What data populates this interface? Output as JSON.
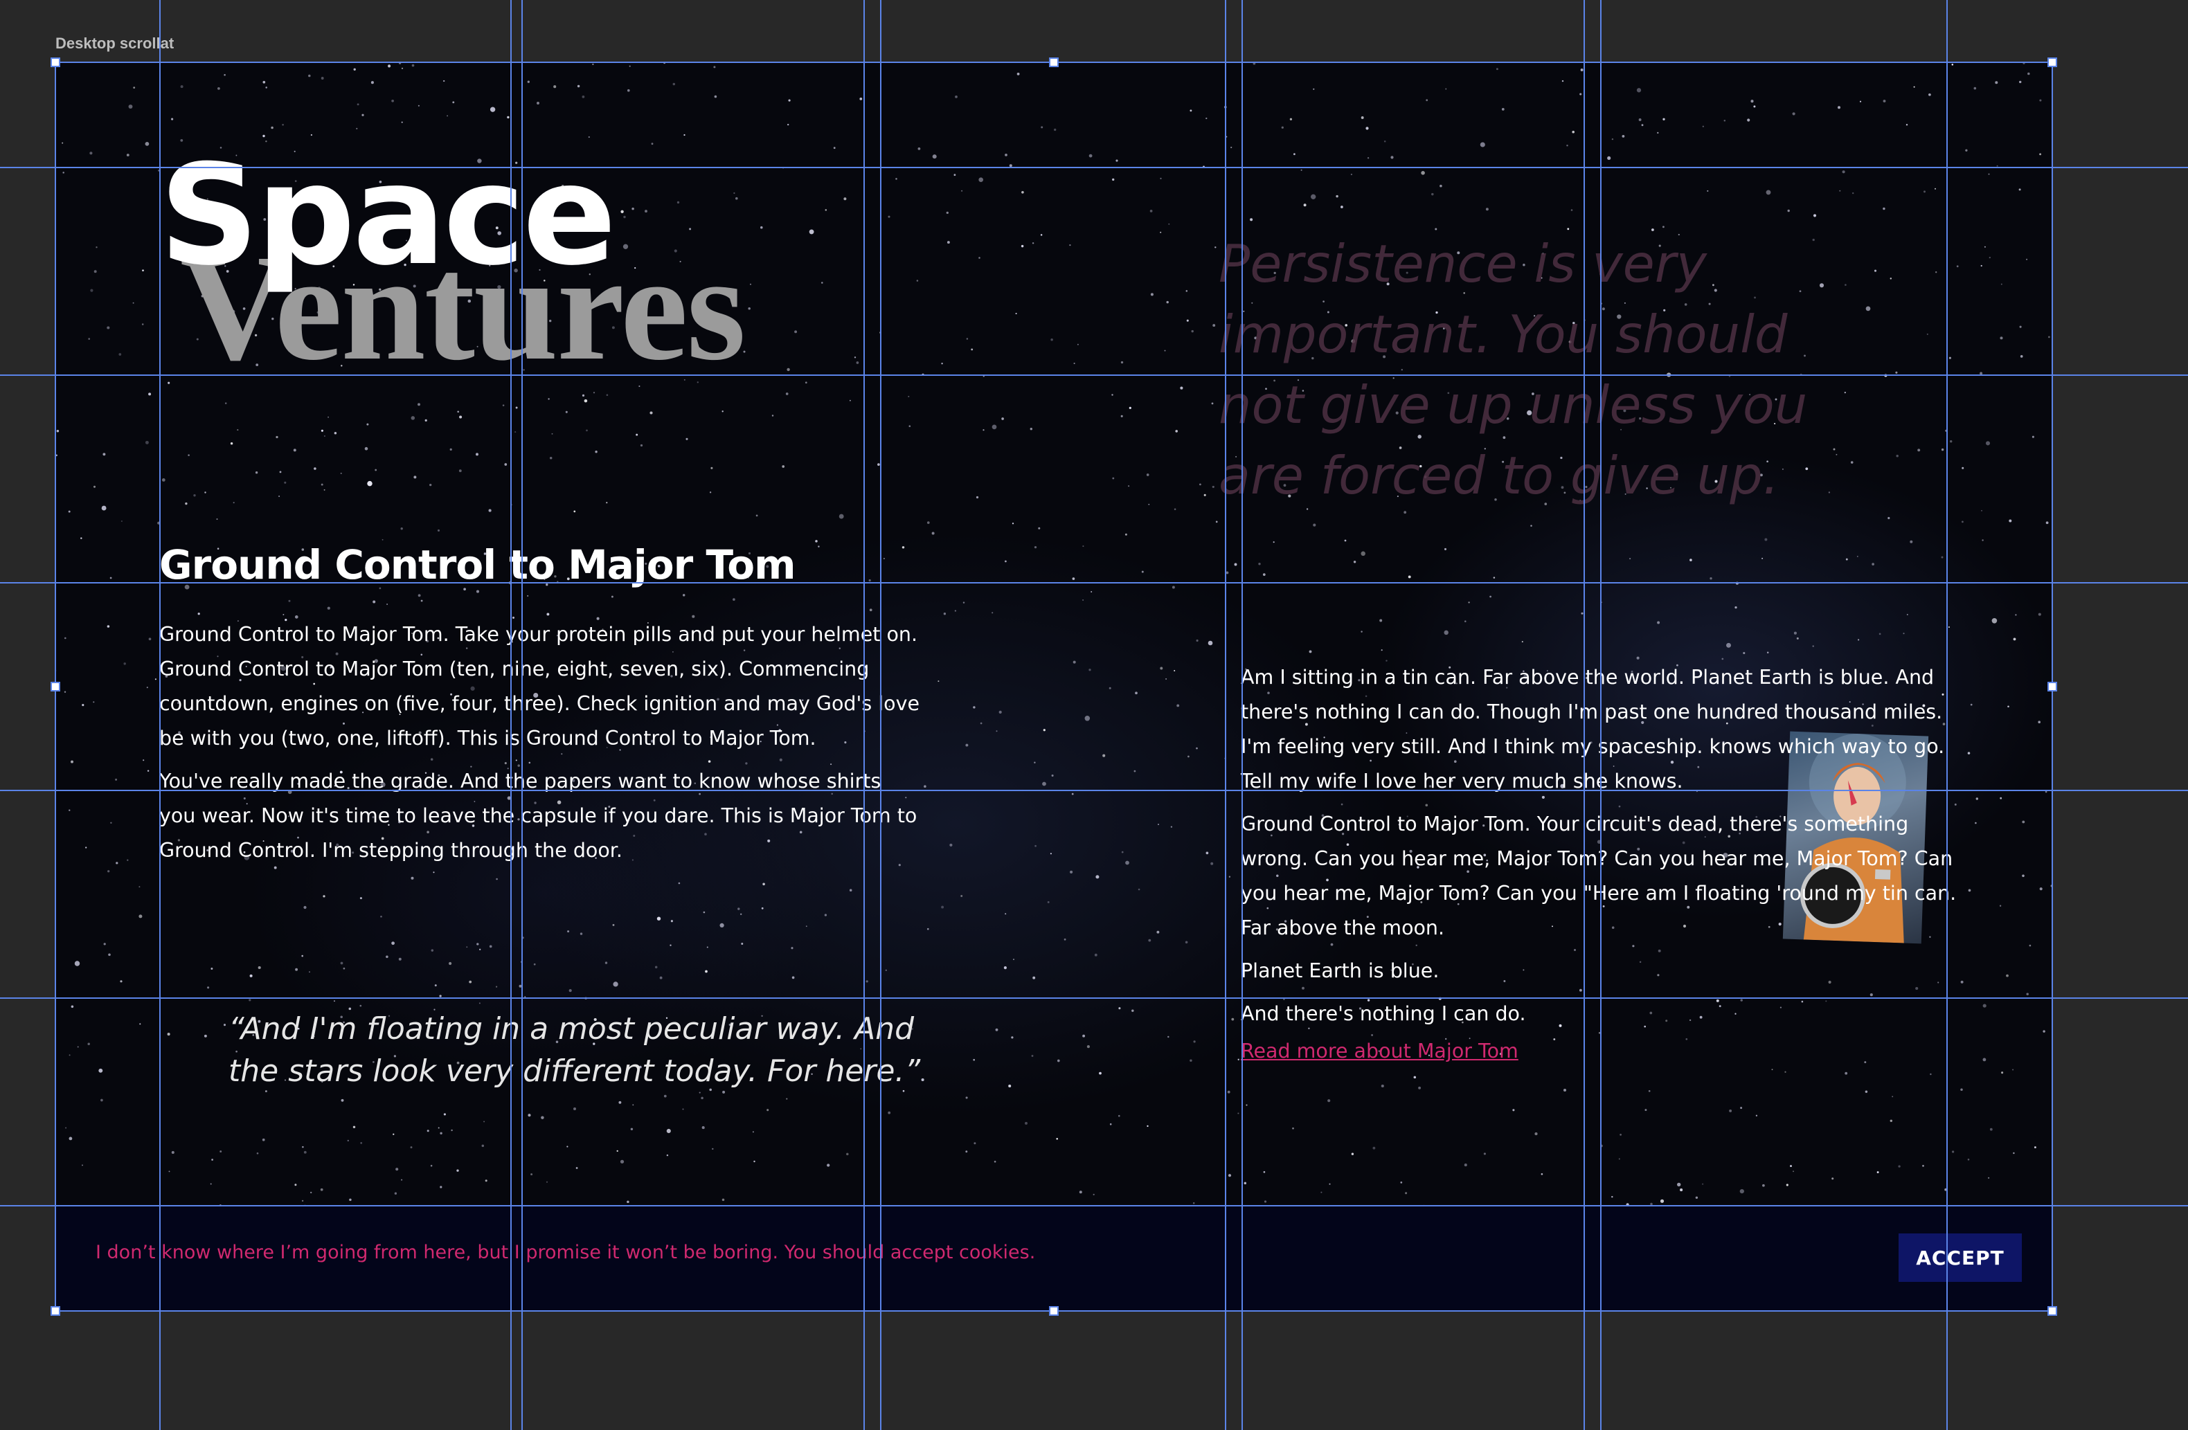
{
  "editor": {
    "frame_label": "Desktop scrollat"
  },
  "hero": {
    "logo_line1": "Space",
    "logo_line2": "Ventures",
    "quote_right": "Persistence is very important. You should not give up unless you are forced to give up."
  },
  "section": {
    "heading": "Ground Control to Major Tom",
    "left_paragraphs": [
      "Ground Control to Major Tom. Take your protein pills and put your helmet on. Ground Control to Major Tom (ten, nine, eight, seven, six). Commencing countdown, engines on (five, four, three). Check ignition and may God's love be with you (two, one, liftoff). This is Ground Control to Major Tom.",
      "You've really made the grade. And the papers want to know whose shirts you wear. Now it's time to leave the capsule if you dare. This is Major Tom to Ground Control. I'm stepping through the door."
    ],
    "quote_left": "“And I'm floating in a most peculiar way. And the stars look very different today. For here.”",
    "right_paragraphs": [
      "Am I sitting in a tin can. Far above the world. Planet Earth is blue. And there's nothing I can do.  Though I'm past one hundred thousand miles. I'm  feeling very still. And I think my spaceship. knows which way to go. Tell my wife I love her very much she knows.",
      "Ground Control to Major Tom. Your circuit's dead, there's something wrong. Can you hear me, Major Tom? Can you hear me, Major Tom? Can you hear me, Major Tom? Can you \"Here am I floating 'round my tin can. Far above the moon.",
      "Planet Earth is blue.",
      "And there's nothing I can do."
    ],
    "read_more": "Read more about Major Tom"
  },
  "cookie": {
    "message": "I don’t know where I’m going from here, but I promise it won’t be boring. You should accept cookies.",
    "accept_label": "ACCEPT"
  },
  "colors": {
    "accent_pink": "#d0296f",
    "button_navy": "#0e1566",
    "cookie_bar_bg": "#03051a",
    "guide_blue": "#5b84e8",
    "editor_bg": "#282828"
  }
}
